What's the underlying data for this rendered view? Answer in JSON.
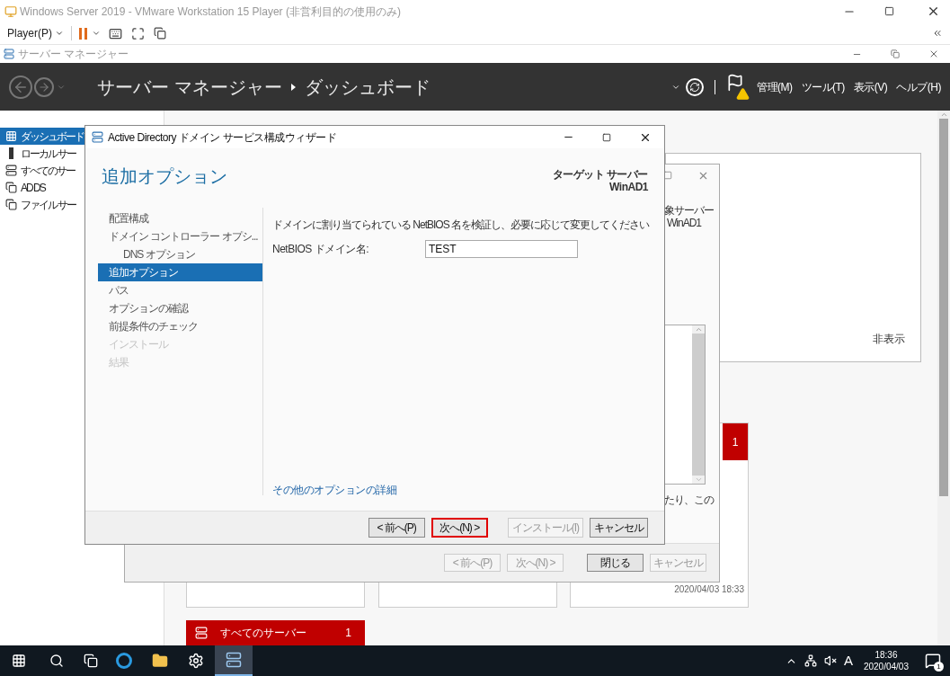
{
  "vm": {
    "title": "Windows Server 2019 - VMware Workstation 15 Player (非営利目的の使用のみ)",
    "player_menu": "Player(P)"
  },
  "server_manager": {
    "title": "サーバー マネージャー",
    "breadcrumb": [
      "サーバー マネージャー",
      "ダッシュボード"
    ],
    "menus": [
      "管理(M)",
      "ツール(T)",
      "表示(V)",
      "ヘルプ(H)"
    ],
    "sidebar": [
      {
        "label": "ダッシュボード",
        "selected": true,
        "kind": "dashboard"
      },
      {
        "label": "ローカル サー",
        "selected": false,
        "kind": "server"
      },
      {
        "label": "すべてのサー",
        "selected": false,
        "kind": "servers"
      },
      {
        "label": "AD DS",
        "selected": false,
        "kind": "role"
      },
      {
        "label": "ファイル サー",
        "selected": false,
        "kind": "role"
      }
    ]
  },
  "background": {
    "panel": {
      "hide_link": "非表示"
    },
    "dialog": {
      "target_label": "象サーバー",
      "target_name": "WinAD1",
      "text_fragment": "たり、この",
      "buttons": [
        {
          "label": "< 前へ(P)",
          "disabled": true
        },
        {
          "label": "次へ(N) >",
          "disabled": true
        },
        {
          "label": "閉じる",
          "disabled": false
        },
        {
          "label": "キャンセル",
          "disabled": true
        }
      ]
    },
    "tile": {
      "count": "1",
      "timestamp": "2020/04/03 18:33"
    },
    "all_servers_tile": {
      "label": "すべてのサーバー",
      "count": "1"
    }
  },
  "wizard": {
    "title": "Active Directory ドメイン サービス構成ウィザード",
    "heading": "追加オプション",
    "target_label": "ターゲット サーバー",
    "target_name": "WinAD1",
    "steps": [
      {
        "label": "配置構成",
        "selected": false,
        "disabled": false
      },
      {
        "label": "ドメイン コントローラー オプシ...",
        "selected": false,
        "disabled": false,
        "children": [
          {
            "label": "DNS オプション",
            "selected": false,
            "disabled": false
          }
        ]
      },
      {
        "label": "追加オプション",
        "selected": true,
        "disabled": false
      },
      {
        "label": "パス",
        "selected": false,
        "disabled": false
      },
      {
        "label": "オプションの確認",
        "selected": false,
        "disabled": false
      },
      {
        "label": "前提条件のチェック",
        "selected": false,
        "disabled": false
      },
      {
        "label": "インストール",
        "selected": false,
        "disabled": true
      },
      {
        "label": "結果",
        "selected": false,
        "disabled": true
      }
    ],
    "instruction": "ドメインに割り当てられている NetBIOS 名を検証し、必要に応じて変更してください",
    "field": {
      "label": "NetBIOS ドメイン名:",
      "value": "TEST"
    },
    "link": "その他のオプションの詳細",
    "buttons": [
      {
        "label": "< 前へ(P)",
        "disabled": false,
        "highlighted": false
      },
      {
        "label": "次へ(N) >",
        "disabled": false,
        "highlighted": true
      },
      {
        "label": "インストール(I)",
        "disabled": true,
        "highlighted": false
      },
      {
        "label": "キャンセル",
        "disabled": false,
        "highlighted": false
      }
    ]
  },
  "taskbar": {
    "ime": "A",
    "time": "18:36",
    "date": "2020/04/03",
    "notifications": "1"
  }
}
